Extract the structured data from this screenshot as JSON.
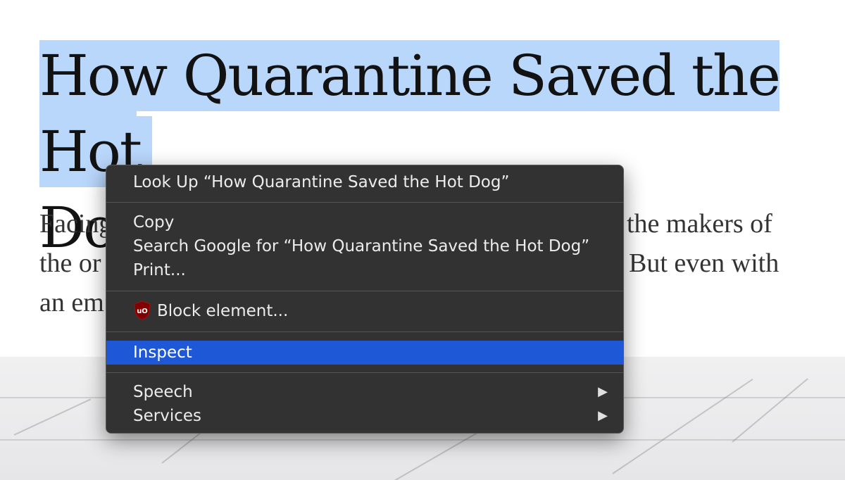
{
  "article": {
    "headline_line1": "How Quarantine Saved the Hot",
    "headline_line2": "Dog",
    "para": {
      "l1_left": "Facing",
      "l1_right": "the makers of",
      "l2_left": "the or",
      "l2_right": "But even with",
      "l3_left": "an em"
    }
  },
  "context_menu": {
    "look_up": "Look Up “How Quarantine Saved the Hot Dog”",
    "copy": "Copy",
    "search_google": "Search Google for “How Quarantine Saved the Hot Dog”",
    "print": "Print...",
    "block_element": "Block element...",
    "inspect": "Inspect",
    "speech": "Speech",
    "services": "Services",
    "selection_color": "#b9d6fb",
    "highlight_color": "#1f58d6"
  }
}
